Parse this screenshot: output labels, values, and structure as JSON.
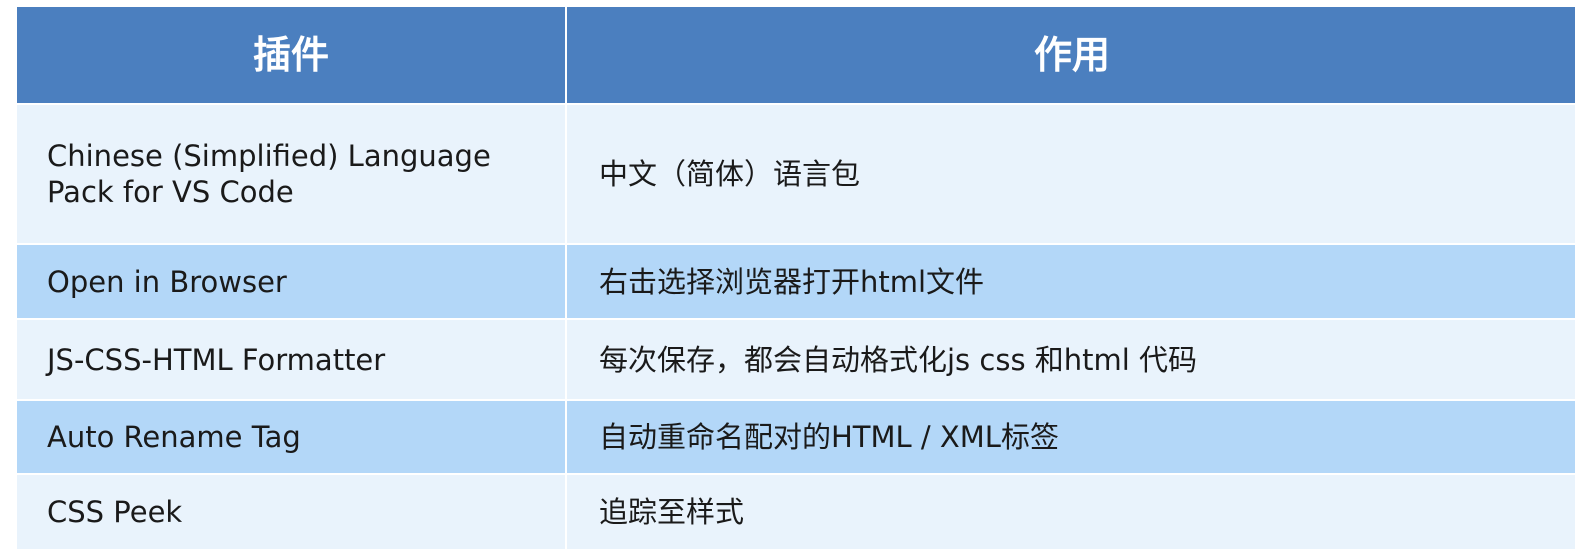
{
  "table": {
    "headers": [
      "插件",
      "作用"
    ],
    "rows": [
      {
        "plugin": "Chinese (Simplified) Language Pack for VS Code",
        "purpose": "中文（简体）语言包"
      },
      {
        "plugin": "Open in Browser",
        "purpose": "右击选择浏览器打开html文件"
      },
      {
        "plugin": "JS-CSS-HTML Formatter",
        "purpose": "每次保存，都会自动格式化js  css 和html 代码"
      },
      {
        "plugin": "Auto Rename Tag",
        "purpose": "自动重命名配对的HTML / XML标签"
      },
      {
        "plugin": "CSS Peek",
        "purpose": "追踪至样式"
      }
    ]
  },
  "colors": {
    "header_bg": "#4b7fbf",
    "row_light_bg": "#e9f3fc",
    "row_dark_bg": "#b3d7f8",
    "text": "#1a1a1a"
  }
}
